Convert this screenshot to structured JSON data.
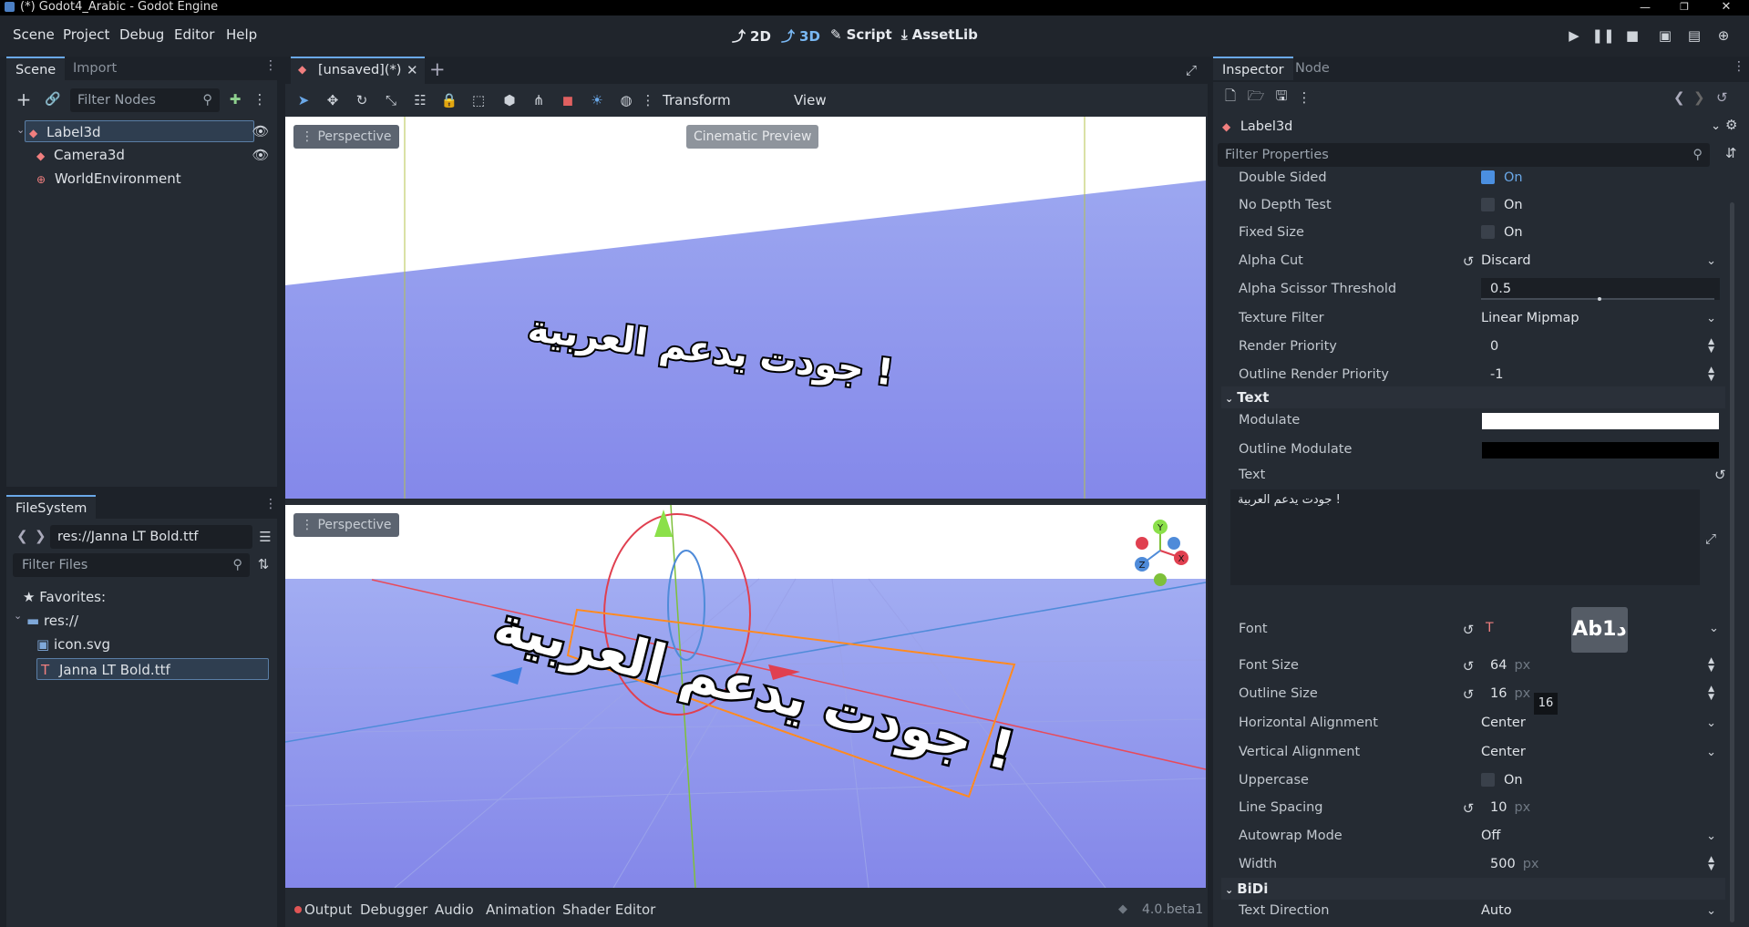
{
  "window": {
    "title": "(*) Godot4_Arabic - Godot Engine"
  },
  "menu": [
    "Scene",
    "Project",
    "Debug",
    "Editor",
    "Help"
  ],
  "workspaces": [
    "2D",
    "3D",
    "Script",
    "AssetLib"
  ],
  "scene_dock": {
    "tabs": [
      "Scene",
      "Import"
    ],
    "filter_placeholder": "Filter Nodes",
    "nodes": [
      "Label3d",
      "Camera3d",
      "WorldEnvironment"
    ]
  },
  "filesystem_dock": {
    "tab": "FileSystem",
    "path": "res://Janna LT Bold.ttf",
    "filter_placeholder": "Filter Files",
    "items": [
      "Favorites:",
      "res://",
      "icon.svg",
      "Janna LT Bold.ttf"
    ]
  },
  "viewport": {
    "tab": "[unsaved](*)",
    "toolbar_menus": [
      "Transform",
      "View"
    ],
    "top_label": "Perspective",
    "cinematic": "Cinematic Preview",
    "bottom_label": "Perspective",
    "arabic_text": "جودت يدعم العربية !",
    "gizmo": {
      "y": "Y",
      "z": "Z",
      "x": "X"
    }
  },
  "bottom_panel": {
    "tabs": [
      "Output",
      "Debugger",
      "Audio",
      "Animation",
      "Shader Editor"
    ],
    "version": "4.0.beta1"
  },
  "inspector": {
    "tabs": [
      "Inspector",
      "Node"
    ],
    "object": "Label3d",
    "filter_placeholder": "Filter Properties",
    "props": {
      "double_sided": {
        "name": "Double Sided",
        "value": "On"
      },
      "no_depth": {
        "name": "No Depth Test",
        "value": "On"
      },
      "fixed_size": {
        "name": "Fixed Size",
        "value": "On"
      },
      "alpha_cut": {
        "name": "Alpha Cut",
        "value": "Discard"
      },
      "alpha_scissor": {
        "name": "Alpha Scissor Threshold",
        "value": "0.5"
      },
      "texture_filter": {
        "name": "Texture Filter",
        "value": "Linear Mipmap"
      },
      "render_priority": {
        "name": "Render Priority",
        "value": "0"
      },
      "outline_render_priority": {
        "name": "Outline Render Priority",
        "value": "-1"
      },
      "text_section": "Text",
      "modulate": {
        "name": "Modulate"
      },
      "outline_modulate": {
        "name": "Outline Modulate"
      },
      "text": {
        "name": "Text",
        "value": "جودت يدعم العربية !"
      },
      "font": {
        "name": "Font",
        "preview": "Abد1"
      },
      "font_size": {
        "name": "Font Size",
        "value": "64",
        "unit": "px"
      },
      "outline_size": {
        "name": "Outline Size",
        "value": "16",
        "unit": "px",
        "tooltip": "16"
      },
      "h_align": {
        "name": "Horizontal Alignment",
        "value": "Center"
      },
      "v_align": {
        "name": "Vertical Alignment",
        "value": "Center"
      },
      "uppercase": {
        "name": "Uppercase",
        "value": "On"
      },
      "line_spacing": {
        "name": "Line Spacing",
        "value": "10",
        "unit": "px"
      },
      "autowrap": {
        "name": "Autowrap Mode",
        "value": "Off"
      },
      "width": {
        "name": "Width",
        "value": "500",
        "unit": "px"
      },
      "bidi_section": "BiDi",
      "text_direction": {
        "name": "Text Direction",
        "value": "Auto"
      }
    }
  },
  "colors": {
    "accent": "#6aa8e8",
    "viewport_floor": "#8c93ea",
    "sky": "#ffffff"
  }
}
